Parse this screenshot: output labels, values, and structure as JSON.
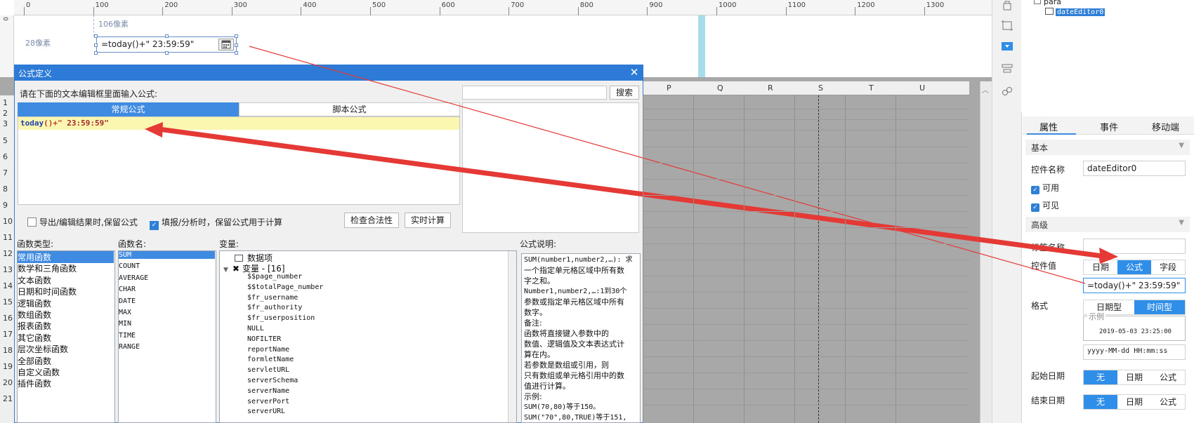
{
  "designer": {
    "ruler_ticks": [
      "0",
      "100",
      "200",
      "300",
      "400",
      "500",
      "600",
      "700",
      "800",
      "900",
      "1000",
      "1100",
      "1200",
      "1300"
    ],
    "vruler_label": "0",
    "guide_top": "106像素",
    "guide_left": "28像素",
    "widget_value": "=today()+\" 23:59:59\""
  },
  "sheet": {
    "columns": [
      "P",
      "Q",
      "R",
      "S",
      "T",
      "U"
    ],
    "rows": [
      "1",
      "2",
      "3",
      "5",
      "6",
      "7",
      "8",
      "9",
      "10",
      "11",
      "12",
      "13",
      "14",
      "15",
      "16",
      "17",
      "18",
      "19",
      "20",
      "21"
    ]
  },
  "dialog": {
    "title": "公式定义",
    "instruction": "请在下面的文本编辑框里面输入公式:",
    "tabs": [
      "常规公式",
      "脚本公式"
    ],
    "formula": {
      "fn": "today",
      "rest": "()+\"",
      "str": " 23:59:59\""
    },
    "search_button": "搜索",
    "check_export": "导出/编辑结果时,保留公式",
    "check_fill": "填报/分析时，保留公式用于计算",
    "btn_check": "检查合法性",
    "btn_realtime": "实时计算",
    "label_func_type": "函数类型:",
    "label_func_name": "函数名:",
    "label_vars": "变量:",
    "label_desc": "公式说明:",
    "func_types": [
      "常用函数",
      "数学和三角函数",
      "文本函数",
      "日期和时间函数",
      "逻辑函数",
      "数组函数",
      "报表函数",
      "其它函数",
      "层次坐标函数",
      "全部函数",
      "自定义函数",
      "插件函数"
    ],
    "func_names": [
      "SUM",
      "COUNT",
      "AVERAGE",
      "CHAR",
      "DATE",
      "MAX",
      "MIN",
      "TIME",
      "RANGE"
    ],
    "vars_root": "数据项",
    "vars_group": "变量 - [16]",
    "vars": [
      "$$page_number",
      "$$totalPage_number",
      "$fr_username",
      "$fr_authority",
      "$fr_userposition",
      "NULL",
      "NOFILTER",
      "reportName",
      "formletName",
      "servletURL",
      "serverSchema",
      "serverName",
      "serverPort",
      "serverURL"
    ],
    "desc_lines": [
      "SUM(number1,number2,…): 求",
      "一个指定单元格区域中所有数",
      "字之和。",
      "Number1,number2,…:1到30个",
      "参数或指定单元格区域中所有",
      "数字。",
      "备注:",
      "    函数将直接键入参数中的",
      "数值、逻辑值及文本表达式计",
      "算在内。",
      "    若参数是数组或引用，则",
      "只有数组或单元格引用中的数",
      "值进行计算。",
      "示例:",
      "SUM(70,80)等于150。",
      "SUM(\"70\",80,TRUE)等于151,"
    ]
  },
  "tree": {
    "parent": "para",
    "child": "dateEditor0"
  },
  "props": {
    "tabs": [
      "属性",
      "事件",
      "移动端"
    ],
    "section_basic": "基本",
    "label_name": "控件名称",
    "name_value": "dateEditor0",
    "check_enabled": "可用",
    "check_visible": "可见",
    "section_advanced": "高级",
    "label_tag": "标签名称",
    "label_value": "控件值",
    "value_modes": [
      "日期",
      "公式",
      "字段"
    ],
    "value_formula": "=today()+\" 23:59:59\"",
    "label_format": "格式",
    "format_modes": [
      "日期型",
      "时间型"
    ],
    "example_legend": "示例",
    "example_value": "2019-05-03 23:25:00",
    "format_pattern": "yyyy-MM-dd HH:mm:ss",
    "label_start": "起始日期",
    "label_end": "结束日期",
    "date_modes": [
      "无",
      "日期",
      "公式"
    ]
  },
  "colors": {
    "accent": "#2f8ee8",
    "arrow": "#e53935",
    "title_bar": "#2e7bd7",
    "formula_bg": "#fbf7b0"
  }
}
